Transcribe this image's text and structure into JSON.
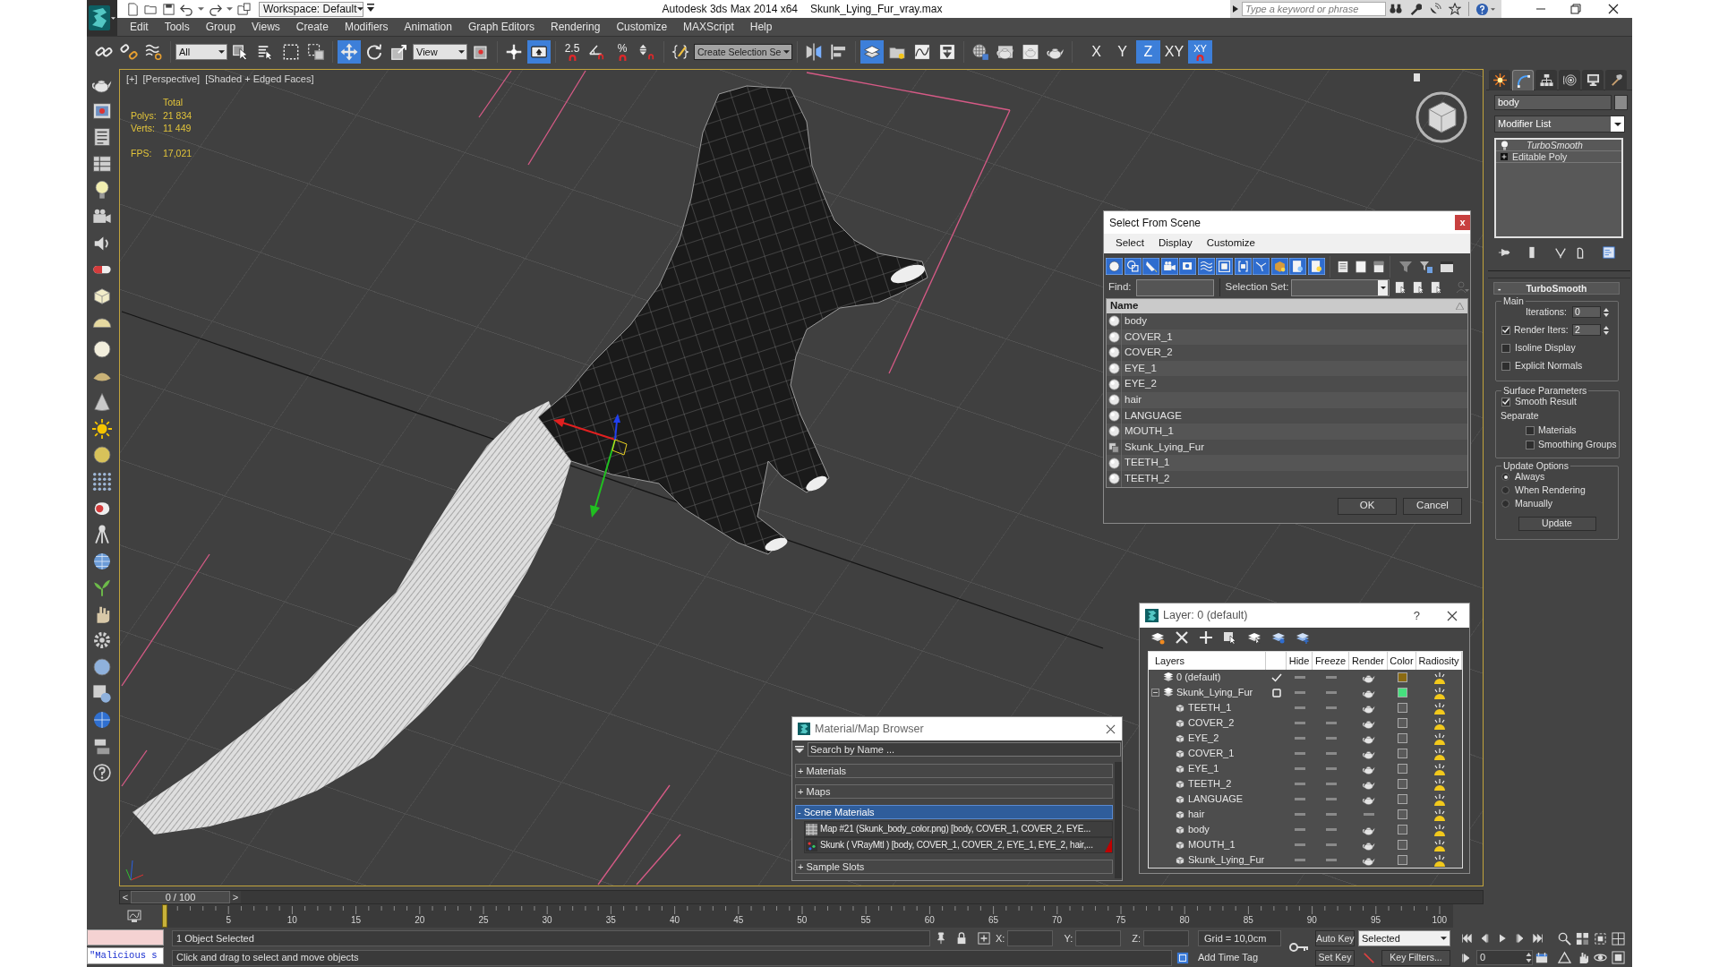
{
  "title_bar": {
    "workspace": "Workspace: Default",
    "app_title": "Autodesk 3ds Max 2014 x64",
    "file_name": "Skunk_Lying_Fur_vray.max",
    "search": {
      "placeholder": "Type a keyword or phrase"
    }
  },
  "menu": [
    "Edit",
    "Tools",
    "Group",
    "Views",
    "Create",
    "Modifiers",
    "Animation",
    "Graph Editors",
    "Rendering",
    "Customize",
    "MAXScript",
    "Help"
  ],
  "main_toolbar": [
    [
      {
        "kind": "link",
        "selected": false
      },
      {
        "kind": "unlink",
        "selected": false
      },
      {
        "kind": "bind",
        "selected": false
      }
    ],
    [
      {
        "kind": "filter_dropdown",
        "value": "All"
      },
      {
        "kind": "select",
        "selected": false
      },
      {
        "kind": "select_by_name",
        "selected": false
      },
      {
        "kind": "region",
        "selected": false
      },
      {
        "kind": "crossing",
        "selected": false
      }
    ],
    [
      {
        "kind": "move",
        "selected": true
      },
      {
        "kind": "rotate",
        "selected": false
      },
      {
        "kind": "scale",
        "selected": false
      },
      {
        "kind": "coord_dropdown",
        "value": "View"
      },
      {
        "kind": "pivot",
        "selected": false
      }
    ],
    [
      {
        "kind": "manipulate",
        "selected": false
      },
      {
        "kind": "keyboard",
        "selected": true
      }
    ],
    [
      {
        "kind": "snap",
        "label": "2.5",
        "selected": false
      },
      {
        "kind": "angle_snap",
        "selected": false
      },
      {
        "kind": "percent_snap",
        "label": "%",
        "selected": false
      },
      {
        "kind": "spinner_snap",
        "selected": false
      }
    ],
    [
      {
        "kind": "named_sets",
        "selected": false
      },
      {
        "kind": "selection_set",
        "value": "Create Selection Se"
      }
    ],
    [
      {
        "kind": "mirror",
        "selected": false
      },
      {
        "kind": "align",
        "selected": false
      }
    ],
    [
      {
        "kind": "layers",
        "selected": true
      },
      {
        "kind": "scene_explorer",
        "selected": false
      },
      {
        "kind": "curve_editor",
        "selected": false
      },
      {
        "kind": "schematic",
        "selected": false
      }
    ],
    [
      {
        "kind": "material_editor",
        "selected": false
      },
      {
        "kind": "render_setup",
        "selected": false
      },
      {
        "kind": "frame_window",
        "selected": false
      },
      {
        "kind": "render",
        "selected": false
      }
    ],
    [
      {
        "kind": "axis",
        "label": "X",
        "selected": false
      },
      {
        "kind": "axis",
        "label": "Y",
        "selected": false
      },
      {
        "kind": "axis",
        "label": "Z",
        "selected": true
      },
      {
        "kind": "axis",
        "label": "XY",
        "selected": false
      },
      {
        "kind": "axis_snap",
        "label": "XY",
        "selected": true
      }
    ]
  ],
  "viewport": {
    "labels": [
      "[+]",
      "[Perspective]",
      "[Shaded + Edged Faces]"
    ],
    "stats": {
      "header": "Total",
      "rows": [
        {
          "kind": "count",
          "label": "Polys:",
          "value": "21 834"
        },
        {
          "kind": "count",
          "label": "Verts:",
          "value": "11 449"
        },
        {
          "kind": "rate",
          "label": "FPS:",
          "value": "17,021"
        }
      ]
    }
  },
  "select_from_scene": {
    "title": "Select From Scene",
    "close": "x",
    "menu": [
      "Select",
      "Display",
      "Customize"
    ],
    "filters": [
      {
        "kind": "geometry",
        "selected": true
      },
      {
        "kind": "shape",
        "selected": true
      },
      {
        "kind": "light",
        "selected": true
      },
      {
        "kind": "camera",
        "selected": true
      },
      {
        "kind": "helper",
        "selected": true
      },
      {
        "kind": "warp",
        "selected": true
      },
      {
        "kind": "group",
        "selected": true
      },
      {
        "kind": "xref",
        "selected": true
      },
      {
        "kind": "bone",
        "selected": true
      },
      {
        "kind": "container",
        "selected": true
      },
      {
        "kind": "frozen",
        "selected": true
      },
      {
        "kind": "hidden",
        "selected": true
      }
    ],
    "find": {
      "label": "Find:"
    },
    "selection_set": {
      "label": "Selection Set:"
    },
    "column": "Name",
    "rows": [
      {
        "name": "body",
        "kind": "geometry",
        "selected": false
      },
      {
        "name": "COVER_1",
        "kind": "geometry",
        "selected": false
      },
      {
        "name": "COVER_2",
        "kind": "geometry",
        "selected": false
      },
      {
        "name": "EYE_1",
        "kind": "geometry",
        "selected": false
      },
      {
        "name": "EYE_2",
        "kind": "geometry",
        "selected": false
      },
      {
        "name": "hair",
        "kind": "geometry",
        "selected": false
      },
      {
        "name": "LANGUAGE",
        "kind": "geometry",
        "selected": false
      },
      {
        "name": "MOUTH_1",
        "kind": "geometry",
        "selected": false
      },
      {
        "name": "Skunk_Lying_Fur",
        "kind": "group",
        "selected": false
      },
      {
        "name": "TEETH_1",
        "kind": "geometry",
        "selected": false
      },
      {
        "name": "TEETH_2",
        "kind": "geometry",
        "selected": false
      }
    ],
    "buttons": [
      "OK",
      "Cancel"
    ]
  },
  "layer_manager": {
    "title": "Layer: 0 (default)",
    "help": "?",
    "columns": [
      "Layers",
      "Hide",
      "Freeze",
      "Render",
      "Color",
      "Radiosity"
    ],
    "layers": [
      {
        "name": "0 (default)",
        "current": true,
        "color": "#8a6a12",
        "hide": false,
        "freeze": false,
        "render": true
      },
      {
        "name": "Skunk_Lying_Fur",
        "current": false,
        "expanded": true,
        "color": "#46e07e",
        "hide": false,
        "freeze": false,
        "render": true,
        "children": [
          {
            "name": "TEETH_1",
            "color": "#5a5a5a",
            "hide": false,
            "freeze": false,
            "render": true
          },
          {
            "name": "COVER_2",
            "color": "#5a5a5a",
            "hide": false,
            "freeze": false,
            "render": true
          },
          {
            "name": "EYE_2",
            "color": "#5a5a5a",
            "hide": false,
            "freeze": false,
            "render": true
          },
          {
            "name": "COVER_1",
            "color": "#5a5a5a",
            "hide": false,
            "freeze": false,
            "render": true
          },
          {
            "name": "EYE_1",
            "color": "#5a5a5a",
            "hide": false,
            "freeze": false,
            "render": true
          },
          {
            "name": "TEETH_2",
            "color": "#5a5a5a",
            "hide": false,
            "freeze": false,
            "render": true
          },
          {
            "name": "LANGUAGE",
            "color": "#5a5a5a",
            "hide": false,
            "freeze": false,
            "render": true
          },
          {
            "name": "hair",
            "color": "#5a5a5a",
            "hide": false,
            "freeze": false,
            "render": false
          },
          {
            "name": "body",
            "color": "#5a5a5a",
            "hide": false,
            "freeze": false,
            "render": true
          },
          {
            "name": "MOUTH_1",
            "color": "#5a5a5a",
            "hide": false,
            "freeze": false,
            "render": true
          },
          {
            "name": "Skunk_Lying_Fur",
            "color": "#5a5a5a",
            "hide": false,
            "freeze": false,
            "render": true
          }
        ]
      }
    ]
  },
  "material_browser": {
    "title": "Material/Map Browser",
    "search": {
      "placeholder": "Search by Name ..."
    },
    "groups": [
      {
        "label": "+ Materials",
        "selected": false
      },
      {
        "label": "+ Maps",
        "selected": false
      },
      {
        "label": "- Scene Materials",
        "selected": true,
        "items": [
          {
            "kind": "map",
            "label": "Map #21 (Skunk_body_color.png) [body, COVER_1, COVER_2, EYE..."
          },
          {
            "kind": "material",
            "label": "Skunk ( VRayMtl ) [body, COVER_1, COVER_2, EYE_1, EYE_2, hair,..."
          }
        ]
      },
      {
        "label": "+ Sample Slots",
        "selected": false
      }
    ]
  },
  "command_panel": {
    "tabs": [
      {
        "kind": "create",
        "selected": false
      },
      {
        "kind": "modify",
        "selected": true
      },
      {
        "kind": "hierarchy",
        "selected": false
      },
      {
        "kind": "motion",
        "selected": false
      },
      {
        "kind": "display",
        "selected": false
      },
      {
        "kind": "utilities",
        "selected": false
      }
    ],
    "object_name": "body",
    "modifier_list": "Modifier List",
    "stack": [
      {
        "kind": "modifier",
        "name": "TurboSmooth"
      },
      {
        "kind": "base",
        "name": "Editable Poly"
      }
    ],
    "rollout": {
      "collapse": "-",
      "title": "TurboSmooth",
      "groups": [
        {
          "title": "Main",
          "items": [
            {
              "kind": "spinner",
              "label": "Iterations:",
              "value": "0"
            },
            {
              "kind": "check_spinner",
              "label": "Render Iters:",
              "value": "2",
              "checked": true
            },
            {
              "kind": "checkbox",
              "label": "Isoline Display",
              "checked": false
            },
            {
              "kind": "checkbox",
              "label": "Explicit Normals",
              "checked": false
            }
          ]
        },
        {
          "title": "Surface Parameters",
          "items": [
            {
              "kind": "checkbox",
              "label": "Smooth Result",
              "checked": true
            },
            {
              "kind": "label",
              "label": "Separate"
            },
            {
              "kind": "sub_checkbox",
              "label": "Materials",
              "checked": false
            },
            {
              "kind": "sub_checkbox",
              "label": "Smoothing Groups",
              "checked": false
            }
          ]
        },
        {
          "title": "Update Options",
          "items": [
            {
              "kind": "radio",
              "label": "Always",
              "selected": true
            },
            {
              "kind": "radio",
              "label": "When Rendering",
              "selected": false
            },
            {
              "kind": "radio",
              "label": "Manually",
              "selected": false
            },
            {
              "kind": "button",
              "label": "Update"
            }
          ]
        }
      ]
    }
  },
  "timeline": {
    "slider": {
      "prev": "<",
      "label": "0 / 100",
      "next": ">",
      "level": 0
    },
    "ticks": [
      "5",
      "10",
      "15",
      "20",
      "25",
      "30",
      "35",
      "40",
      "45",
      "50",
      "55",
      "60",
      "65",
      "70",
      "75",
      "80",
      "85",
      "90",
      "95",
      "100"
    ]
  },
  "status_bar": {
    "listener": "\"Malicious s",
    "selection": "1 Object Selected",
    "prompt": "Click and drag to select and move objects",
    "coords": [
      "X:",
      "Y:",
      "Z:"
    ],
    "grid": "Grid = 10,0cm",
    "time_tag": "Add Time Tag",
    "auto_key": {
      "label": "Auto Key",
      "selected": false
    },
    "key_mode": "Selected",
    "set_key": "Set Key",
    "key_filters": "Key Filters...",
    "frame": "0"
  }
}
